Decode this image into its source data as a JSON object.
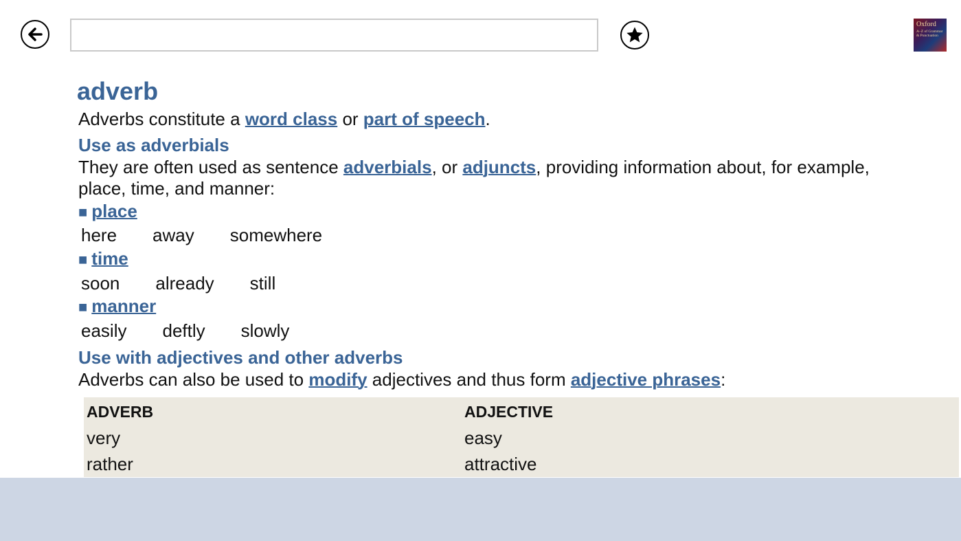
{
  "toolbar": {
    "back_icon": "back-arrow-icon",
    "favorite_icon": "star-icon",
    "search": {
      "value": "",
      "placeholder": ""
    },
    "book_cover": {
      "title": "Oxford",
      "subtitle": "A–Z of Grammar & Punctuation"
    }
  },
  "entry": {
    "headword": "adverb",
    "intro": {
      "t1": "Adverbs constitute a ",
      "link1": "word class",
      "t2": " or ",
      "link2": "part of speech",
      "t3": "."
    },
    "section1": {
      "heading": "Use as adverbials",
      "p_t1": "They are often used as sentence ",
      "p_link1": "adverbials",
      "p_t2": ", or ",
      "p_link2": "adjuncts",
      "p_t3": ", providing information about, for example,",
      "p_line2": "place, time, and manner:",
      "categories": [
        {
          "bullet": "■",
          "label": "place",
          "examples": [
            "here",
            "away",
            "somewhere"
          ]
        },
        {
          "bullet": "■",
          "label": "time",
          "examples": [
            "soon",
            "already",
            "still"
          ]
        },
        {
          "bullet": "■",
          "label": "manner",
          "examples": [
            "easily",
            "deftly",
            "slowly"
          ]
        }
      ]
    },
    "section2": {
      "heading": "Use with adjectives and other adverbs",
      "p_t1": "Adverbs can also be used to ",
      "p_link1": "modify",
      "p_t2": " adjectives and thus form ",
      "p_link2": "adjective phrases",
      "p_t3": ":"
    },
    "table": {
      "headers": [
        "ADVERB",
        "ADJECTIVE"
      ],
      "rows": [
        [
          "very",
          "easy"
        ],
        [
          "rather",
          "attractive"
        ]
      ]
    }
  },
  "colors": {
    "accent": "#3a6496",
    "table_bg": "#ece9e0",
    "footer_bg": "#cdd6e4"
  }
}
